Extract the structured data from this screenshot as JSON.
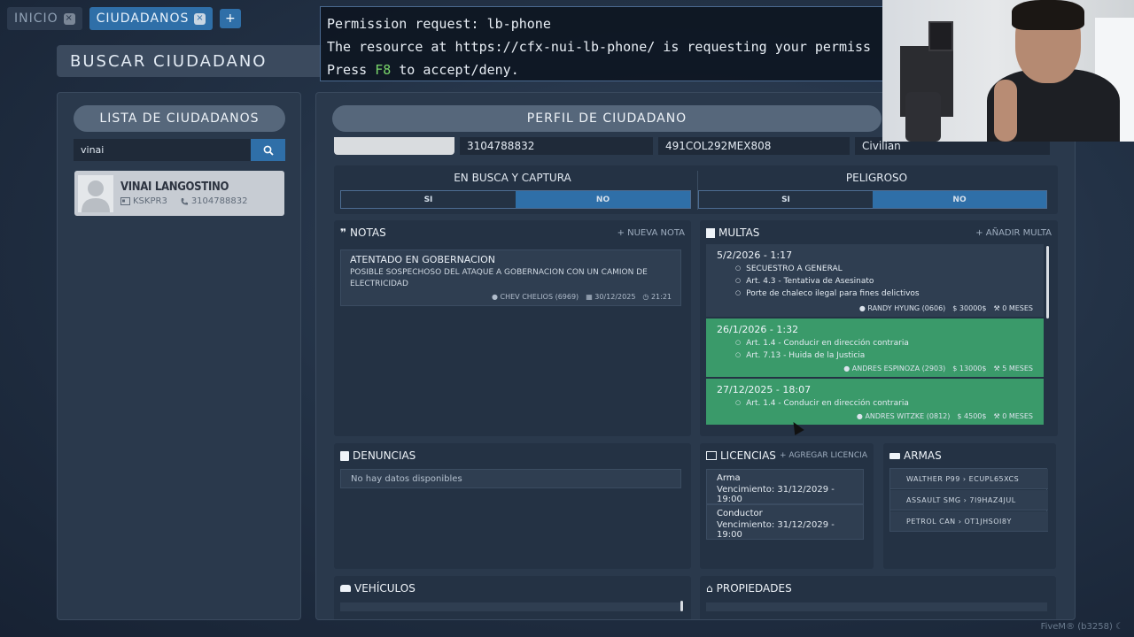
{
  "tabs": [
    {
      "label": "INICIO"
    },
    {
      "label": "CIUDADANOS"
    },
    {
      "label": "+"
    }
  ],
  "tab_close_glyph": "×",
  "search_title": "BUSCAR CIUDADANO",
  "permission": {
    "line1": "Permission request: lb-phone",
    "line2": "The resource at https://cfx-nui-lb-phone/ is requesting your permiss",
    "line3_pre": "Press ",
    "line3_key": "F8",
    "line3_post": " to accept/deny."
  },
  "left_panel": {
    "header": "LISTA DE CIUDADANOS",
    "search_value": "vinai",
    "citizen": {
      "name": "VINAI LANGOSTINO",
      "id": "KSKPR3",
      "phone": "3104788832"
    }
  },
  "profile": {
    "header": "PERFIL DE CIUDADANO",
    "phone": "3104788832",
    "document": "491COL292MEX808",
    "job": "Civilian",
    "wanted": {
      "title": "EN BUSCA Y CAPTURA",
      "yes": "SI",
      "no": "NO",
      "selected": "NO"
    },
    "dangerous": {
      "title": "PELIGROSO",
      "yes": "SI",
      "no": "NO",
      "selected": "NO"
    }
  },
  "notas": {
    "title": "NOTAS",
    "action": "+ NUEVA NOTA",
    "item": {
      "title": "ATENTADO EN GOBERNACION",
      "desc": "POSIBLE SOSPECHOSO DEL ATAQUE A GOBERNACION CON UN CAMION DE ELECTRICIDAD",
      "author": "CHEV CHELIOS (6969)",
      "date": "30/12/2025",
      "time": "21:21"
    }
  },
  "multas": {
    "title": "MULTAS",
    "action": "+ AÑADIR MULTA",
    "items": [
      {
        "date": "5/2/2026 - 1:17",
        "arts": [
          "SECUESTRO A GENERAL",
          "Art. 4.3 - Tentativa de Asesinato",
          "Porte de chaleco ilegal para fines delictivos"
        ],
        "officer": "RANDY HYUNG (0606)",
        "amount": "30000$",
        "time": "0 MESES"
      },
      {
        "date": "26/1/2026 - 1:32",
        "arts": [
          "Art. 1.4 - Conducir en dirección contraria",
          "Art. 7.13 - Huida de la Justicia"
        ],
        "officer": "ANDRES ESPINOZA (2903)",
        "amount": "13000$",
        "time": "5 MESES"
      },
      {
        "date": "27/12/2025 - 18:07",
        "arts": [
          "Art. 1.4 - Conducir en dirección contraria"
        ],
        "officer": "ANDRES WITZKE (0812)",
        "amount": "4500$",
        "time": "0 MESES"
      }
    ]
  },
  "denuncias": {
    "title": "DENUNCIAS",
    "empty": "No hay datos disponibles"
  },
  "licencias": {
    "title": "LICENCIAS",
    "action": "+ AGREGAR LICENCIA",
    "items": [
      {
        "name": "Arma",
        "expiry": "Vencimiento: 31/12/2029 - 19:00"
      },
      {
        "name": "Conductor",
        "expiry": "Vencimiento: 31/12/2029 - 19:00"
      }
    ]
  },
  "armas": {
    "title": "ARMAS",
    "items": [
      {
        "name": "WALTHER P99",
        "serial": "ECUPL65XCS"
      },
      {
        "name": "ASSAULT SMG",
        "serial": "7I9HAZ4JUL"
      },
      {
        "name": "PETROL CAN",
        "serial": "OT1JHSOI8Y"
      }
    ]
  },
  "vehiculos": {
    "title": "VEHÍCULOS"
  },
  "propiedades": {
    "title": "PROPIEDADES"
  },
  "footer": "FiveM® (b3258)",
  "colors": {
    "accent": "#2f6fa8",
    "green_row": "#3a9a6a",
    "panel": "#2a394c"
  }
}
